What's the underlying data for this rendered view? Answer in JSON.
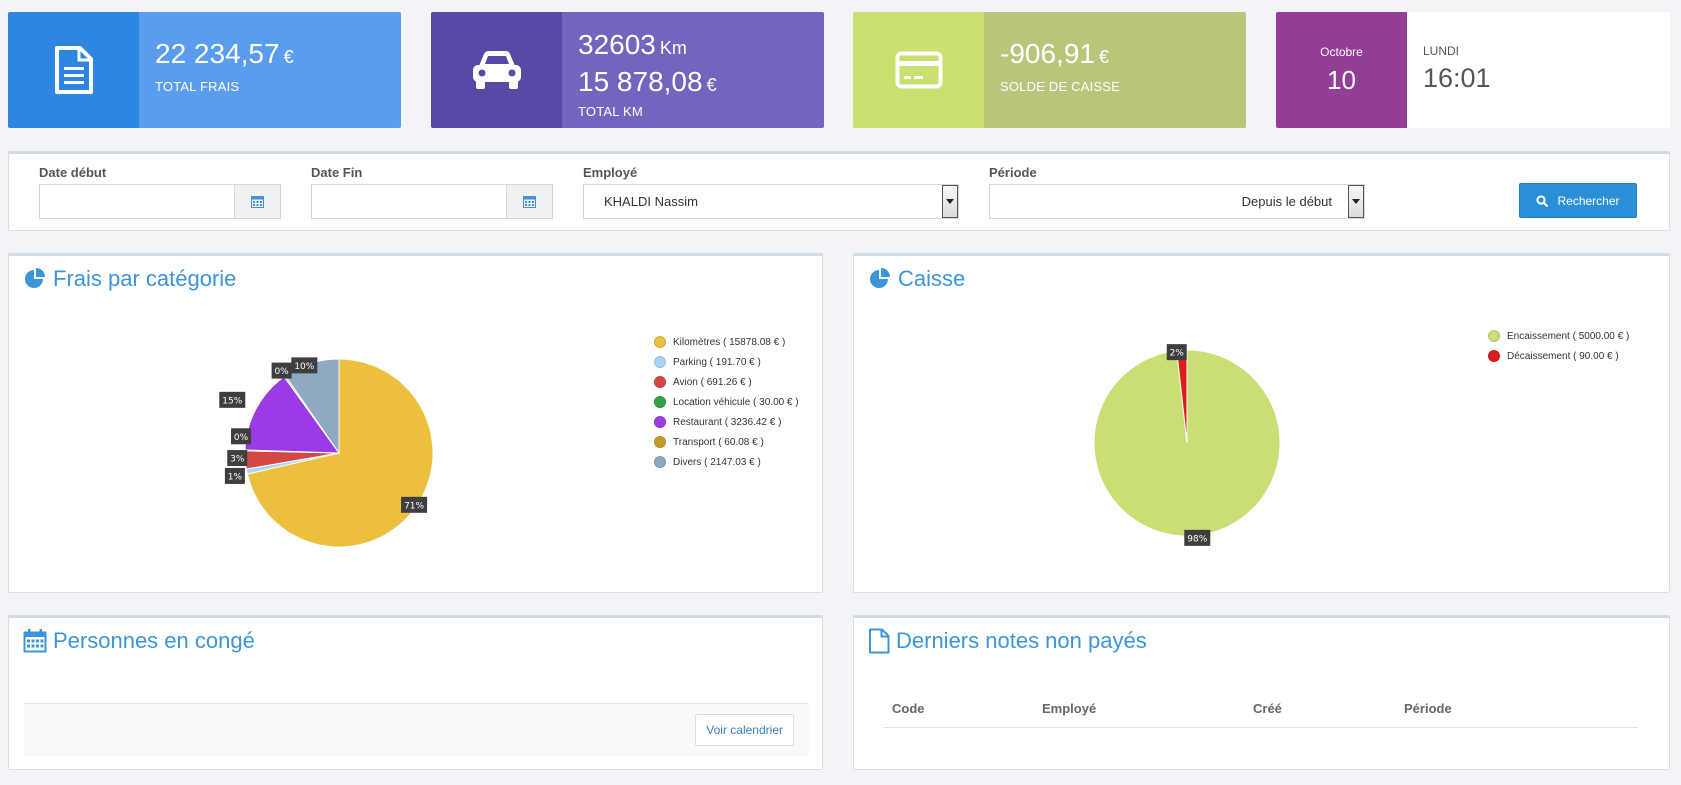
{
  "cards": {
    "frais": {
      "value": "22 234,57",
      "unit": "€",
      "label": "TOTAL FRAIS",
      "icon": "document-icon"
    },
    "km": {
      "distance": "32603",
      "distance_unit": "Km",
      "value": "15 878,08",
      "unit": "€",
      "label": "TOTAL KM",
      "icon": "car-icon"
    },
    "caisse": {
      "value": "-906,91",
      "unit": "€",
      "label": "SOLDE DE CAISSE",
      "icon": "credit-card-icon"
    },
    "date": {
      "month": "Octobre",
      "day": "10",
      "weekday": "LUNDI",
      "time": "16:01"
    }
  },
  "filters": {
    "date_debut_label": "Date début",
    "date_debut_value": "",
    "date_fin_label": "Date Fin",
    "date_fin_value": "",
    "employe_label": "Employé",
    "employe_value": "KHALDI Nassim",
    "periode_label": "Période",
    "periode_value": "Depuis le début",
    "search_label": "Rechercher"
  },
  "frais_panel": {
    "title": "Frais par catégorie",
    "icon": "pie-chart-icon"
  },
  "caisse_panel": {
    "title": "Caisse",
    "icon": "pie-chart-icon"
  },
  "conge_panel": {
    "title": "Personnes en congé",
    "icon": "calendar-icon",
    "button_label": "Voir calendrier"
  },
  "notes_panel": {
    "title": "Derniers notes non payés",
    "icon": "file-icon",
    "columns": [
      "Code",
      "Employé",
      "Créé",
      "Période"
    ]
  },
  "chart_data": [
    {
      "type": "pie",
      "title": "Frais par catégorie",
      "legend_position": "right",
      "slices": [
        {
          "name": "Kilomètres ( 15878.08 € )",
          "value": 15878.08,
          "label": "71%",
          "color": "#ecc03e"
        },
        {
          "name": "Parking ( 191.70 € )",
          "value": 191.7,
          "label": "1%",
          "color": "#a9d4f5"
        },
        {
          "name": "Avion ( 691.26 € )",
          "value": 691.26,
          "label": "3%",
          "color": "#d34747"
        },
        {
          "name": "Location véhicule ( 30.00 € )",
          "value": 30.0,
          "label": "0%",
          "color": "#33a241"
        },
        {
          "name": "Restaurant ( 3236.42 € )",
          "value": 3236.42,
          "label": "15%",
          "color": "#9b3be6"
        },
        {
          "name": "Transport ( 60.08 € )",
          "value": 60.08,
          "label": "0%",
          "color": "#c59c2c"
        },
        {
          "name": "Divers ( 2147.03 € )",
          "value": 2147.03,
          "label": "10%",
          "color": "#8fa9c1"
        }
      ]
    },
    {
      "type": "pie",
      "title": "Caisse",
      "legend_position": "top-right",
      "slices": [
        {
          "name": "Encaissement ( 5000.00 € )",
          "value": 5000.0,
          "label": "98%",
          "color": "#c9de73"
        },
        {
          "name": "Décaissement ( 90.00 € )",
          "value": 90.0,
          "label": "2%",
          "color": "#dd1d1d"
        }
      ]
    }
  ]
}
